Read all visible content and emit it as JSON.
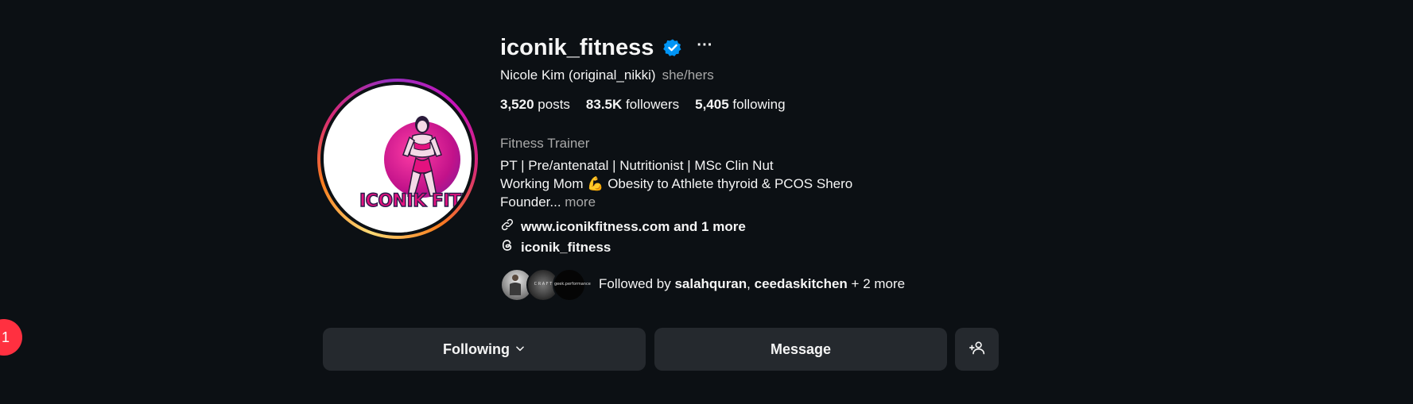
{
  "profile": {
    "username": "iconik_fitness",
    "verified": true,
    "full_name": "Nicole Kim (original_nikki)",
    "pronouns": "she/hers",
    "avatar_logo_text": "ICONIK FITNE"
  },
  "stats": {
    "posts_count": "3,520",
    "posts_label": "posts",
    "followers_count": "83.5K",
    "followers_label": "followers",
    "following_count": "5,405",
    "following_label": "following"
  },
  "bio": {
    "category": "Fitness Trainer",
    "line1": "PT | Pre/antenatal | Nutritionist | MSc Clin Nut",
    "line2_before_emoji": "Working Mom",
    "line2_emoji": "💪",
    "line2_after_emoji": "Obesity to Athlete thyroid & PCOS Shero",
    "line3": "Founder...",
    "more_label": "more"
  },
  "links": {
    "website": "www.iconikfitness.com and 1 more",
    "threads": "iconik_fitness"
  },
  "followed_by": {
    "prefix": "Followed by",
    "user1": "salahquran",
    "separator": ",",
    "user2": "ceedaskitchen",
    "suffix": "+ 2 more",
    "avatar_texts": [
      "",
      "C R A F T",
      "geek.performance"
    ]
  },
  "actions": {
    "following_label": "Following",
    "message_label": "Message"
  },
  "notification": {
    "count": "1"
  },
  "icons": {
    "verified": "verified-badge-icon",
    "more": "more-options-icon",
    "link": "link-icon",
    "threads": "threads-icon",
    "chevron": "chevron-down-icon",
    "add_user": "add-user-icon"
  },
  "colors": {
    "background": "#0c1014",
    "verified_blue": "#0095f6",
    "button_bg": "#25292e",
    "badge_red": "#ff3040",
    "secondary_text": "#a8a8a8"
  }
}
